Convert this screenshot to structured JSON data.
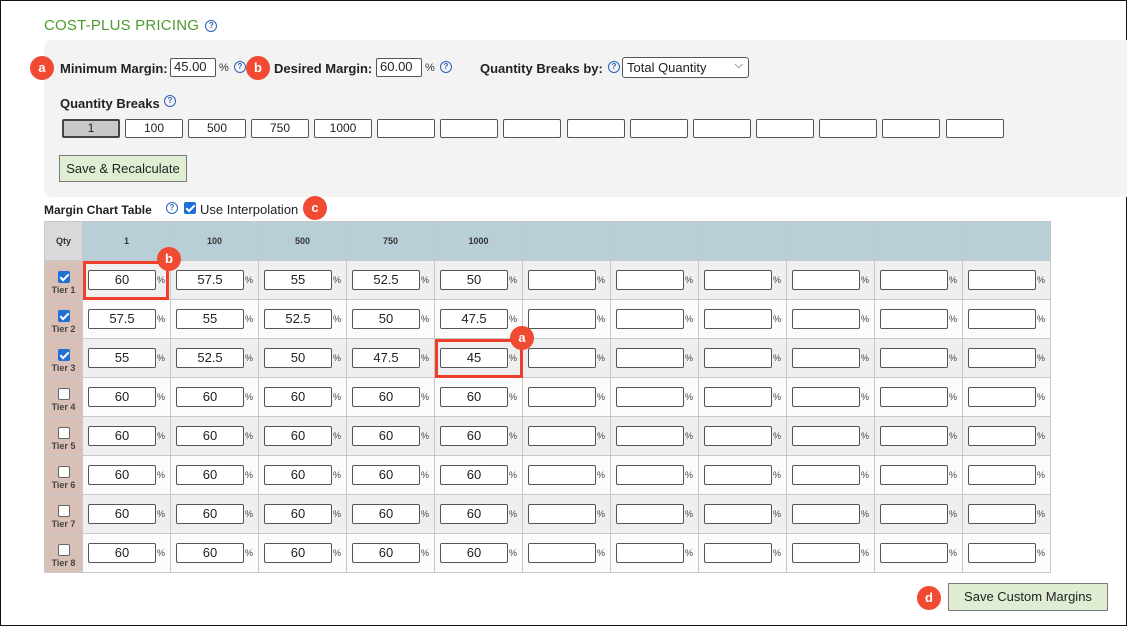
{
  "title": "COST-PLUS PRICING",
  "settings": {
    "min_margin_label": "Minimum Margin:",
    "min_margin_value": "45.00",
    "desired_margin_label": "Desired Margin:",
    "desired_margin_value": "60.00",
    "percent": "%",
    "qty_breaks_by_label": "Quantity Breaks by:",
    "qty_breaks_by_value": "Total Quantity",
    "qty_breaks_label": "Quantity Breaks",
    "qty_breaks": [
      "1",
      "100",
      "500",
      "750",
      "1000",
      "",
      "",
      "",
      "",
      "",
      "",
      "",
      "",
      "",
      ""
    ],
    "save_recalc_label": "Save & Recalculate"
  },
  "chart": {
    "label": "Margin Chart Table",
    "interpolation_label": "Use Interpolation",
    "interpolation_checked": true,
    "qty_header": "Qty",
    "columns": [
      "1",
      "100",
      "500",
      "750",
      "1000",
      "",
      "",
      "",
      "",
      "",
      ""
    ],
    "tiers": [
      {
        "label": "Tier 1",
        "checked": true,
        "values": [
          "60",
          "57.5",
          "55",
          "52.5",
          "50",
          "",
          "",
          "",
          "",
          "",
          ""
        ]
      },
      {
        "label": "Tier 2",
        "checked": true,
        "values": [
          "57.5",
          "55",
          "52.5",
          "50",
          "47.5",
          "",
          "",
          "",
          "",
          "",
          ""
        ]
      },
      {
        "label": "Tier 3",
        "checked": true,
        "values": [
          "55",
          "52.5",
          "50",
          "47.5",
          "45",
          "",
          "",
          "",
          "",
          "",
          ""
        ]
      },
      {
        "label": "Tier 4",
        "checked": false,
        "values": [
          "60",
          "60",
          "60",
          "60",
          "60",
          "",
          "",
          "",
          "",
          "",
          ""
        ]
      },
      {
        "label": "Tier 5",
        "checked": false,
        "values": [
          "60",
          "60",
          "60",
          "60",
          "60",
          "",
          "",
          "",
          "",
          "",
          ""
        ]
      },
      {
        "label": "Tier 6",
        "checked": false,
        "values": [
          "60",
          "60",
          "60",
          "60",
          "60",
          "",
          "",
          "",
          "",
          "",
          ""
        ]
      },
      {
        "label": "Tier 7",
        "checked": false,
        "values": [
          "60",
          "60",
          "60",
          "60",
          "60",
          "",
          "",
          "",
          "",
          "",
          ""
        ]
      },
      {
        "label": "Tier 8",
        "checked": false,
        "values": [
          "60",
          "60",
          "60",
          "60",
          "60",
          "",
          "",
          "",
          "",
          "",
          ""
        ]
      }
    ],
    "save_custom_label": "Save Custom Margins"
  },
  "annotations": {
    "badge_a": "a",
    "badge_b": "b",
    "badge_c": "c",
    "badge_d": "d"
  },
  "colors": {
    "title_green": "#4e9a2f",
    "badge_red": "#f04a33",
    "header_blue": "#b8cfd8",
    "tier_tan": "#d8c0b6",
    "button_green": "#dfeed3"
  },
  "icons": {
    "help": "help-circle-icon"
  }
}
